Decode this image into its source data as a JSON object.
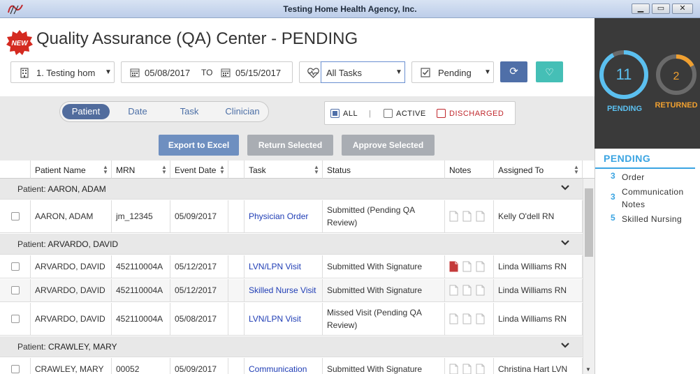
{
  "window": {
    "title": "Testing Home Health Agency, Inc."
  },
  "header": {
    "new_badge": "NEW",
    "page_title": "Quality Assurance (QA) Center - PENDING",
    "agency_select": "1. Testing hom",
    "date_from": "05/08/2017",
    "date_to_label": "TO",
    "date_to": "05/15/2017",
    "task_select": "All Tasks",
    "status_select": "Pending"
  },
  "toolbar": {
    "segments": [
      "Patient",
      "Date",
      "Task",
      "Clinician"
    ],
    "active_segment": "Patient",
    "filters": {
      "all": "ALL",
      "sep": "|",
      "active": "ACTIVE",
      "discharged": "DISCHARGED"
    },
    "export_label": "Export to Excel",
    "return_label": "Return Selected",
    "approve_label": "Approve Selected"
  },
  "table": {
    "columns": [
      "Patient Name",
      "MRN",
      "Event Date",
      "Task",
      "Status",
      "Notes",
      "Assigned To"
    ],
    "groups": [
      {
        "label": "Patient:",
        "name": "AARON, ADAM",
        "rows": [
          {
            "patient": "AARON, ADAM",
            "mrn": "jm_12345",
            "date": "05/09/2017",
            "task": "Physician Order",
            "status": "Submitted (Pending QA Review)",
            "assigned": "Kelly O'dell RN",
            "note_flag": false
          }
        ]
      },
      {
        "label": "Patient:",
        "name": "ARVARDO, DAVID",
        "rows": [
          {
            "patient": "ARVARDO, DAVID",
            "mrn": "452110004A",
            "date": "05/12/2017",
            "task": "LVN/LPN Visit",
            "status": "Submitted With Signature",
            "assigned": "Linda Williams RN",
            "note_flag": true
          },
          {
            "patient": "ARVARDO, DAVID",
            "mrn": "452110004A",
            "date": "05/12/2017",
            "task": "Skilled Nurse Visit",
            "status": "Submitted With Signature",
            "assigned": "Linda Williams RN",
            "note_flag": false
          },
          {
            "patient": "ARVARDO, DAVID",
            "mrn": "452110004A",
            "date": "05/08/2017",
            "task": "LVN/LPN Visit",
            "status": "Missed Visit (Pending QA Review)",
            "assigned": "Linda Williams RN",
            "note_flag": false
          }
        ]
      },
      {
        "label": "Patient:",
        "name": "CRAWLEY, MARY",
        "rows": [
          {
            "patient": "CRAWLEY, MARY",
            "mrn": "00052",
            "date": "05/09/2017",
            "task": "Communication",
            "status": "Submitted With Signature",
            "assigned": "Christina Hart LVN",
            "note_flag": false
          }
        ]
      }
    ]
  },
  "sidebar": {
    "pending_count": "11",
    "pending_label": "PENDING",
    "pending_fraction": 0.92,
    "returned_count": "2",
    "returned_label": "RETURNED",
    "returned_fraction": 0.17,
    "panel_title": "PENDING",
    "items": [
      {
        "count": "3",
        "label": "Order"
      },
      {
        "count": "3",
        "label": "Communication Notes"
      },
      {
        "count": "5",
        "label": "Skilled Nursing"
      }
    ]
  },
  "colors": {
    "accent": "#516c9d",
    "pending": "#5bc0f0",
    "returned": "#f0a030",
    "link": "#1f3db5"
  }
}
